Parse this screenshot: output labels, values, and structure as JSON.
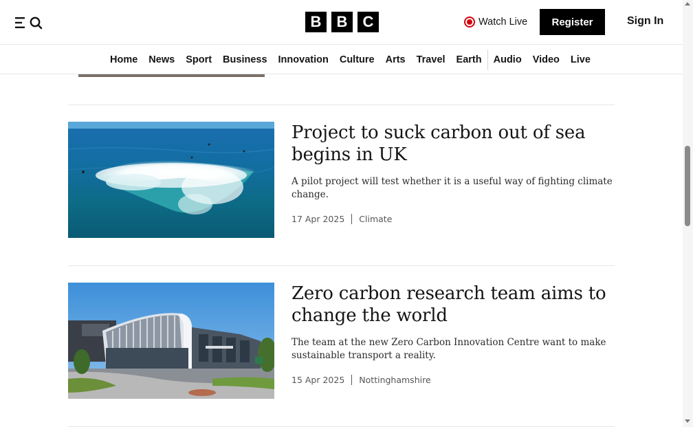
{
  "header": {
    "logo_letters": [
      "B",
      "B",
      "C"
    ],
    "watch_live_label": "Watch Live",
    "register_label": "Register",
    "sign_in_label": "Sign In"
  },
  "nav": {
    "items": [
      "Home",
      "News",
      "Sport",
      "Business",
      "Innovation",
      "Culture",
      "Arts",
      "Travel",
      "Earth",
      "Audio",
      "Video",
      "Live"
    ]
  },
  "articles": [
    {
      "headline": "Project to suck carbon out of sea begins in UK",
      "summary": "A pilot project will test whether it is a useful way of fighting climate change.",
      "date": "17 Apr 2025",
      "tag": "Climate"
    },
    {
      "headline": "Zero carbon research team aims to change the world",
      "summary": "The team at the new Zero Carbon Innovation Centre want to make sustainable transport a reality.",
      "date": "15 Apr 2025",
      "tag": "Nottinghamshire"
    }
  ],
  "colors": {
    "brand_black": "#000000",
    "live_red": "#d4020f",
    "divider": "#e6e6e6"
  }
}
